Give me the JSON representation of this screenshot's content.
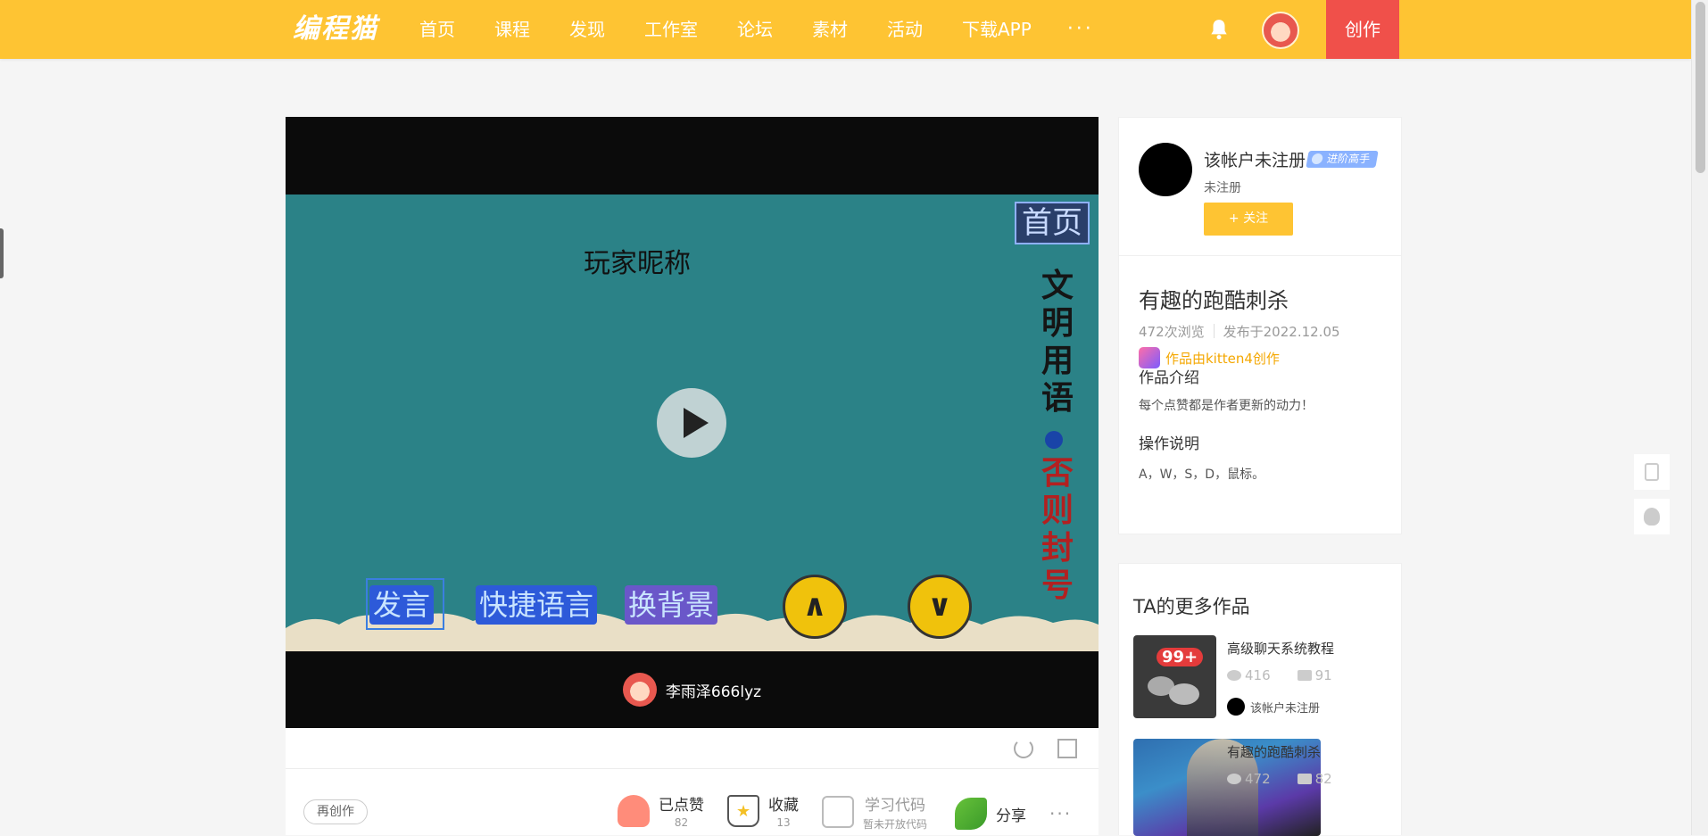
{
  "topbar": {
    "logo": "编程猫",
    "nav": [
      "首页",
      "课程",
      "发现",
      "工作室",
      "论坛",
      "素材",
      "活动",
      "下载APP"
    ],
    "more": "···",
    "create": "创作",
    "accent": "#fec433",
    "create_color": "#f0504a"
  },
  "player": {
    "stage": {
      "home": "首页",
      "nick_label": "玩家昵称",
      "vertical_1": [
        "文",
        "明",
        "用",
        "语"
      ],
      "vertical_2": [
        "否",
        "则",
        "封",
        "号"
      ],
      "btn_speak": "发言",
      "btn_quick": "快捷语言",
      "btn_bg": "换背景",
      "btn_up": "∧",
      "btn_down": "∨",
      "bg_color": "#2b8287"
    },
    "author": "李雨泽666lyz"
  },
  "actions": {
    "recreate": "再创作",
    "like": {
      "label": "已点赞",
      "count": "82"
    },
    "fav": {
      "label": "收藏",
      "count": "13"
    },
    "code": {
      "label": "学习代码",
      "sub": "暂未开放代码"
    },
    "share": {
      "label": "分享"
    },
    "more": "···"
  },
  "profile": {
    "name": "该帐户未注册",
    "badge": "进阶高手",
    "sub": "未注册",
    "follow": "+ 关注"
  },
  "detail": {
    "title": "有趣的跑酷刺杀",
    "views": "472次浏览",
    "published": "发布于2022.12.05",
    "made_by": "作品由kitten4创作",
    "intro_h": "作品介绍",
    "intro_t": "每个点赞都是作者更新的动力！",
    "ops_h": "操作说明",
    "ops_t": "A，W，S，D，鼠标。"
  },
  "more_works": {
    "title": "TA的更多作品",
    "items": [
      {
        "title": "高级聊天系统教程",
        "views": "416",
        "likes": "91",
        "author": "该帐户未注册",
        "thumb_badge": "99+"
      },
      {
        "title": "有趣的跑酷刺杀",
        "views": "472",
        "likes": "82"
      }
    ]
  }
}
